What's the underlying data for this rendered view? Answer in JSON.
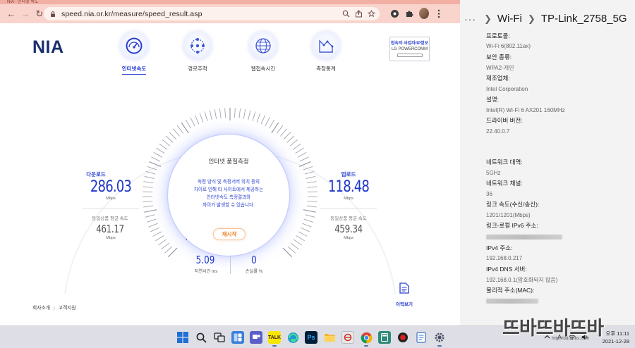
{
  "browser": {
    "tab_title_ghost": "NIA · 인터넷 속도",
    "url": "speed.nia.or.kr/measure/speed_result.asp"
  },
  "site": {
    "logo": "NIA",
    "nav": [
      {
        "label": "인터넷속도",
        "icon": "speedometer-icon",
        "active": true
      },
      {
        "label": "경로추적",
        "icon": "route-trace-icon",
        "active": false
      },
      {
        "label": "웹접속시간",
        "icon": "web-access-icon",
        "active": false
      },
      {
        "label": "측정통계",
        "icon": "statistics-icon",
        "active": false
      }
    ],
    "isp": {
      "title": "접속자 사업자/IP정보",
      "name": "LG POWERCOMM"
    }
  },
  "measure": {
    "download_label": "다운로드",
    "download_value": "286.03",
    "download_unit": "Mbps",
    "download_avg_label": "동일상품 평균 속도",
    "download_avg_value": "461.17",
    "download_avg_unit": "Mbps",
    "upload_label": "업로드",
    "upload_value": "118.48",
    "upload_unit": "Mbps",
    "upload_avg_label": "동일상품 평균 속도",
    "upload_avg_value": "459.34",
    "upload_avg_unit": "Mbps",
    "center_title": "인터넷 품질측정",
    "center_msg": [
      "측정 방식 및 측정서버 위치 등의",
      "차이로 인해 타 사이트에서 제공하는",
      "인터넷속도 측정결과와",
      "차이가 발생할 수 있습니다."
    ],
    "retry_label": "재시작",
    "latency_value": "5.09",
    "latency_label": "지연시간 ms",
    "loss_value": "0",
    "loss_label": "손실률 %",
    "gauge_progress": 0.62
  },
  "footer": {
    "links": [
      "회사소개",
      "고객지원"
    ],
    "history_label": "이력보기"
  },
  "settings": {
    "breadcrumb_dots": "···",
    "breadcrumb_parent": "Wi-Fi",
    "breadcrumb_current": "TP-Link_2758_5G",
    "props": [
      {
        "label": "프로토콜:",
        "value": "Wi-Fi 6(802.11ax)"
      },
      {
        "label": "보안 종류:",
        "value": "WPA2-개인"
      },
      {
        "label": "제조업체:",
        "value": "Intel Corporation"
      },
      {
        "label": "설명:",
        "value": "Intel(R) Wi-Fi 6 AX201 160MHz"
      },
      {
        "label": "드라이버 버전:",
        "value": "22.40.0.7"
      },
      {
        "label": "네트워크 대역:",
        "value": "5GHz"
      },
      {
        "label": "네트워크 채널:",
        "value": "36"
      },
      {
        "label": "링크 속도(수신/송신):",
        "value": "1201/1201(Mbps)"
      },
      {
        "label": "링크-로컬 IPv6 주소:",
        "value": ""
      },
      {
        "label": "IPv4 주소:",
        "value": "192.168.0.217"
      },
      {
        "label": "IPv4 DNS 서버:",
        "value": "192.168.0.1(암호화되지 않음)"
      },
      {
        "label": "물리적 주소(MAC):",
        "value": ""
      }
    ]
  },
  "taskbar": {
    "apps": [
      "windows-start-icon",
      "search-icon",
      "task-view-icon",
      "widgets-icon",
      "chat-icon",
      "kakaotalk-icon",
      "edge-icon",
      "photoshop-icon",
      "file-explorer-icon",
      "app-icon",
      "chrome-icon",
      "calculator-icon",
      "record-icon",
      "notepad-icon",
      "settings-icon"
    ],
    "clock_time": "오후 11:11",
    "clock_date": "2021-12-28",
    "ps_label": "Ps"
  },
  "watermark": {
    "text": "뜨바뜨바뜨바",
    "url": "http://ddumbs.com"
  },
  "colors": {
    "accent": "#2a3fd0",
    "retry": "#ea7b18",
    "chrome_toolbar": "#f8d4cd"
  }
}
